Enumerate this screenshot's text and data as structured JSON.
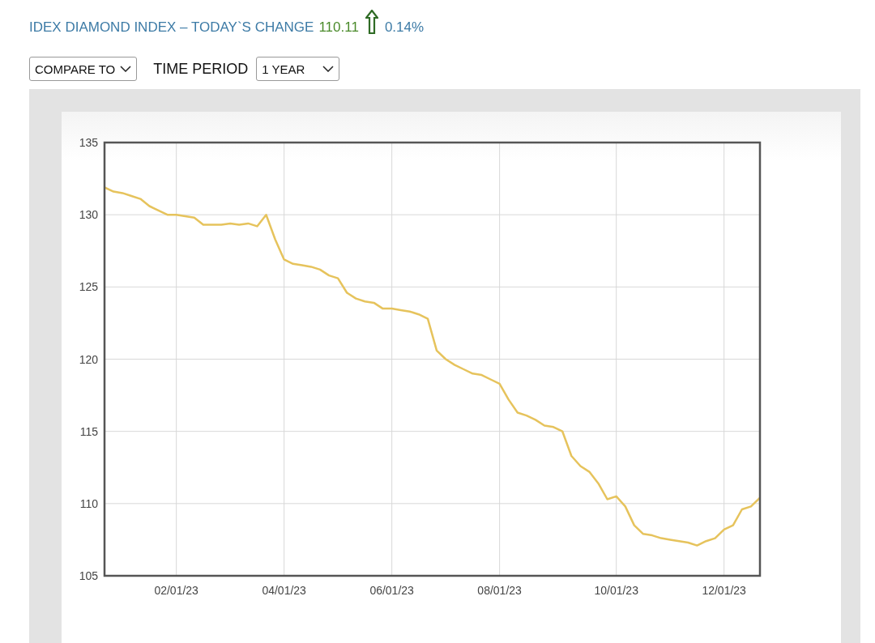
{
  "header": {
    "title": "IDEX DIAMOND INDEX – TODAY`S CHANGE",
    "change_value": "110.11",
    "rising": true,
    "change_percent": "0.14%"
  },
  "controls": {
    "compare": {
      "value": "COMPARE TO"
    },
    "time_period": {
      "label": "TIME PERIOD",
      "value": "1 YEAR"
    }
  },
  "chart": {
    "chart_data": {
      "type": "line",
      "grid": true,
      "ylim": [
        105,
        135
      ],
      "yticks": [
        105,
        110,
        115,
        120,
        125,
        130,
        135
      ],
      "categories": [
        null,
        null,
        null,
        null,
        null,
        null,
        null,
        null,
        "02/01/23",
        null,
        null,
        null,
        null,
        null,
        null,
        null,
        null,
        null,
        null,
        null,
        "04/01/23",
        null,
        null,
        null,
        null,
        null,
        null,
        null,
        null,
        null,
        null,
        null,
        "06/01/23",
        null,
        null,
        null,
        null,
        null,
        null,
        null,
        null,
        null,
        null,
        null,
        "08/01/23",
        null,
        null,
        null,
        null,
        null,
        null,
        null,
        null,
        null,
        null,
        null,
        null,
        "10/01/23",
        null,
        null,
        null,
        null,
        null,
        null,
        null,
        null,
        null,
        null,
        null,
        "12/01/23",
        null,
        null,
        null,
        null
      ],
      "series": [
        {
          "color": "#e6c35c",
          "values": [
            131.9,
            131.6,
            131.5,
            131.3,
            131.1,
            130.6,
            130.3,
            130.0,
            130.0,
            129.9,
            129.8,
            129.3,
            129.3,
            129.3,
            129.4,
            129.3,
            129.4,
            129.2,
            130.0,
            128.3,
            126.9,
            126.6,
            126.5,
            126.4,
            126.2,
            125.8,
            125.6,
            124.6,
            124.2,
            124.0,
            123.9,
            123.5,
            123.5,
            123.4,
            123.3,
            123.1,
            122.8,
            120.6,
            120.0,
            119.6,
            119.3,
            119.0,
            118.9,
            118.6,
            118.3,
            117.2,
            116.3,
            116.1,
            115.8,
            115.4,
            115.3,
            115.0,
            113.3,
            112.6,
            112.2,
            111.4,
            110.3,
            110.5,
            109.8,
            108.5,
            107.9,
            107.8,
            107.6,
            107.5,
            107.4,
            107.3,
            107.1,
            107.4,
            107.6,
            108.2,
            108.5,
            109.6,
            109.8,
            110.4
          ]
        }
      ]
    }
  }
}
